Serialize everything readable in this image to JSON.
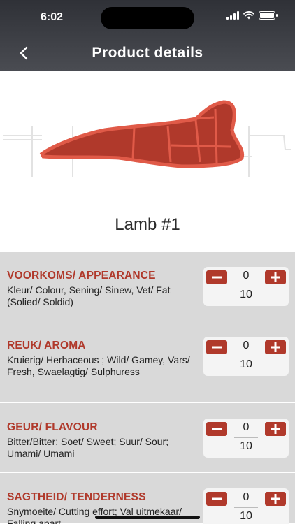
{
  "status_bar": {
    "time": "6:02"
  },
  "header": {
    "title": "Product details"
  },
  "product": {
    "name": "Lamb #1"
  },
  "colors": {
    "accent": "#b0392b",
    "header": "#3b3d42",
    "row_bg": "#d9d9d9"
  },
  "attributes": [
    {
      "title": "VOORKOMS/ APPEARANCE",
      "description": "Kleur/ Colour, Sening/ Sinew, Vet/ Fat (Solied/ Soldid)",
      "value": "0",
      "max": "10"
    },
    {
      "title": "REUK/ AROMA",
      "description": "Kruierig/ Herbaceous ; Wild/ Gamey, Vars/ Fresh, Swaelagtig/ Sulphuress",
      "value": "0",
      "max": "10"
    },
    {
      "title": "GEUR/ FLAVOUR",
      "description": "Bitter/Bitter; Soet/ Sweet; Suur/ Sour; Umami/ Umami",
      "value": "0",
      "max": "10"
    },
    {
      "title": "SAGTHEID/ TENDERNESS",
      "description": "Snymoeite/ Cutting effort; Val uitmekaar/ Falling apart",
      "value": "0",
      "max": "10"
    }
  ],
  "icons": {
    "back": "chevron-left-icon",
    "minus": "minus-icon",
    "plus": "plus-icon",
    "wifi": "wifi-icon",
    "battery": "battery-icon",
    "signal": "signal-icon"
  }
}
